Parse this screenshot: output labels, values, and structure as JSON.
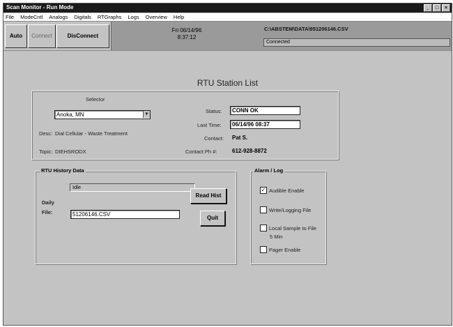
{
  "window": {
    "title": "Scan Monitor - Run Mode",
    "controls": [
      "_",
      "□",
      "×"
    ]
  },
  "menu": [
    "File",
    "ModeCntl",
    "Analogs",
    "Digitals",
    "RTGraphs",
    "Logs",
    "Overview",
    "Help"
  ],
  "toolbar": {
    "auto": "Auto",
    "connect": "Connect",
    "disconnect": "DisConnect",
    "date": "Fri 06/14/96",
    "time": "8:37:12",
    "path": "C:\\ABSTEM\\DATA\\951206146.CSV",
    "status": "Connected"
  },
  "page_title": "RTU Station List",
  "station": {
    "select_label": "Selector",
    "selected": "Anoka, MN",
    "desc_label": "Desc:",
    "desc_value": "Dial Cellular - Waste Treatment",
    "topic_label": "Topic:",
    "topic_value": "DIEHSRODX",
    "status_label": "Status:",
    "status_value": "CONN OK",
    "last_time_label": "Last Time:",
    "last_time_value": "06/14/96 08:37",
    "contact_label": "Contact:",
    "contact_value": "Pat S.",
    "contact_ph_label": "Contact Ph #:",
    "contact_ph_value": "612-928-8872"
  },
  "history": {
    "label": "RTU History Data",
    "status": "Idle",
    "daily_label": "Daily",
    "file_label": "File:",
    "file_value": "51206146.CSV",
    "read_button": "Read Hist",
    "quit_button": "Quit"
  },
  "alarm": {
    "label": "Alarm / Log",
    "items": [
      {
        "label": "Audible Enable",
        "checked": true
      },
      {
        "label": "Write/Logging File",
        "checked": false
      },
      {
        "label": "Local Sample to File",
        "checked": false
      },
      {
        "label": "5 Min",
        "checked": null
      },
      {
        "label": "Pager Enable",
        "checked": false
      }
    ]
  }
}
